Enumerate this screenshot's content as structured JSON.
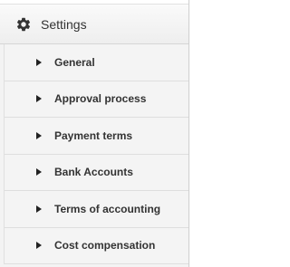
{
  "header": {
    "icon": "gear-icon",
    "title": "Settings"
  },
  "menu": {
    "items": [
      {
        "label": "General"
      },
      {
        "label": "Approval process"
      },
      {
        "label": "Payment terms"
      },
      {
        "label": "Bank Accounts"
      },
      {
        "label": "Terms of accounting"
      },
      {
        "label": "Cost compensation"
      }
    ]
  },
  "colors": {
    "text": "#333333",
    "background": "#f4f4f4",
    "divider": "#dedede"
  }
}
